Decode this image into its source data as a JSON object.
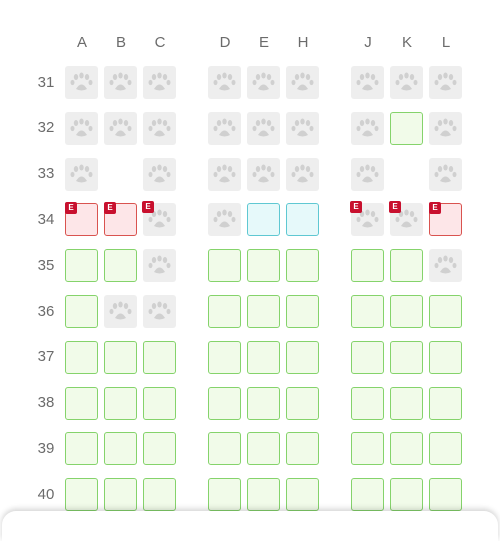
{
  "columns": [
    "A",
    "B",
    "C",
    "D",
    "E",
    "H",
    "J",
    "K",
    "L"
  ],
  "rows": [
    {
      "number": "31",
      "seats": [
        "occupied",
        "occupied",
        "occupied",
        "occupied",
        "occupied",
        "occupied",
        "occupied",
        "occupied",
        "occupied"
      ]
    },
    {
      "number": "32",
      "seats": [
        "occupied",
        "occupied",
        "occupied",
        "occupied",
        "occupied",
        "occupied",
        "occupied",
        "available",
        "occupied"
      ]
    },
    {
      "number": "33",
      "seats": [
        "occupied",
        "none",
        "occupied",
        "occupied",
        "occupied",
        "occupied",
        "occupied",
        "none",
        "occupied"
      ]
    },
    {
      "number": "34",
      "seats": [
        "exit",
        "exit",
        "exit-occupied",
        "occupied",
        "premium",
        "premium",
        "exit-occupied",
        "exit-occupied",
        "exit"
      ]
    },
    {
      "number": "35",
      "seats": [
        "available",
        "available",
        "occupied",
        "available",
        "available",
        "available",
        "available",
        "available",
        "occupied"
      ]
    },
    {
      "number": "36",
      "seats": [
        "available",
        "occupied",
        "occupied",
        "available",
        "available",
        "available",
        "available",
        "available",
        "available"
      ]
    },
    {
      "number": "37",
      "seats": [
        "available",
        "available",
        "available",
        "available",
        "available",
        "available",
        "available",
        "available",
        "available"
      ]
    },
    {
      "number": "38",
      "seats": [
        "available",
        "available",
        "available",
        "available",
        "available",
        "available",
        "available",
        "available",
        "available"
      ]
    },
    {
      "number": "39",
      "seats": [
        "available",
        "available",
        "available",
        "available",
        "available",
        "available",
        "available",
        "available",
        "available"
      ]
    },
    {
      "number": "40",
      "seats": [
        "available",
        "available",
        "available",
        "available",
        "available",
        "available",
        "available",
        "available",
        "available"
      ]
    }
  ],
  "exit_badge": "E",
  "occupied_icon": "paw-icon",
  "colors": {
    "available_fill": "#f1fbe9",
    "available_border": "#85d36b",
    "occupied_fill": "#eeeeee",
    "occupied_icon": "#d0d0d0",
    "premium_fill": "#e6f9fa",
    "premium_border": "#5fc8d2",
    "exit_fill": "#fde6e8",
    "exit_border": "#d9534f",
    "exit_badge": "#c8102e",
    "label_text": "#6b6b6b"
  }
}
